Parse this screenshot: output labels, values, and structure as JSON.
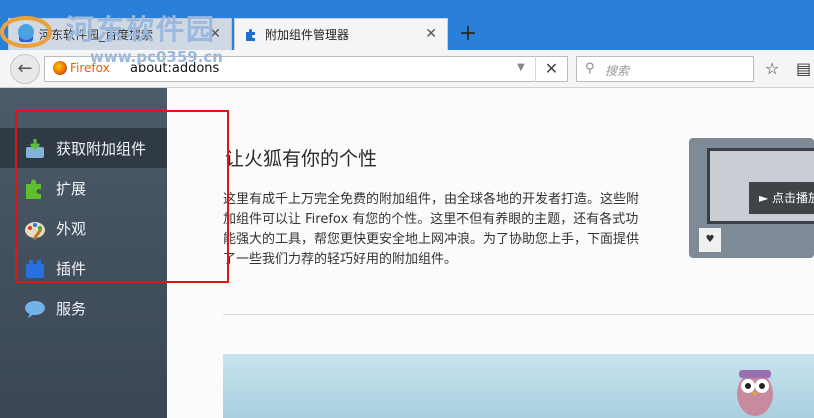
{
  "tabs": [
    {
      "label": "河东软件园_百度搜索",
      "state": "inactive"
    },
    {
      "label": "附加组件管理器",
      "state": "active"
    }
  ],
  "watermark": {
    "title": "河东软件园",
    "url": "www.pc0359.cn"
  },
  "navbar": {
    "identity_label": "Firefox",
    "url": "about:addons",
    "search_placeholder": "搜索"
  },
  "sidebar": {
    "items": [
      {
        "label": "获取附加组件",
        "icon": "download-box-icon",
        "selected": true
      },
      {
        "label": "扩展",
        "icon": "puzzle-piece-icon",
        "selected": false
      },
      {
        "label": "外观",
        "icon": "palette-icon",
        "selected": false
      },
      {
        "label": "插件",
        "icon": "lego-brick-icon",
        "selected": false
      },
      {
        "label": "服务",
        "icon": "chat-bubble-icon",
        "selected": false
      }
    ]
  },
  "main": {
    "heading": "让火狐有你的个性",
    "description": "这里有成千上万完全免费的附加组件，由全球各地的开发者打造。这些附加组件可以让 Firefox 有您的个性。这里不但有养眼的主题，还有各式功能强大的工具，帮您更快更安全地上网冲浪。为了协助您上手，下面提供了一些我们力荐的轻巧好用的附加组件。",
    "hero_button": "► 点击播放"
  },
  "colors": {
    "titlebar": "#2a7fd9",
    "sidebar": "#4c5b6a",
    "highlight": "#e01515"
  }
}
